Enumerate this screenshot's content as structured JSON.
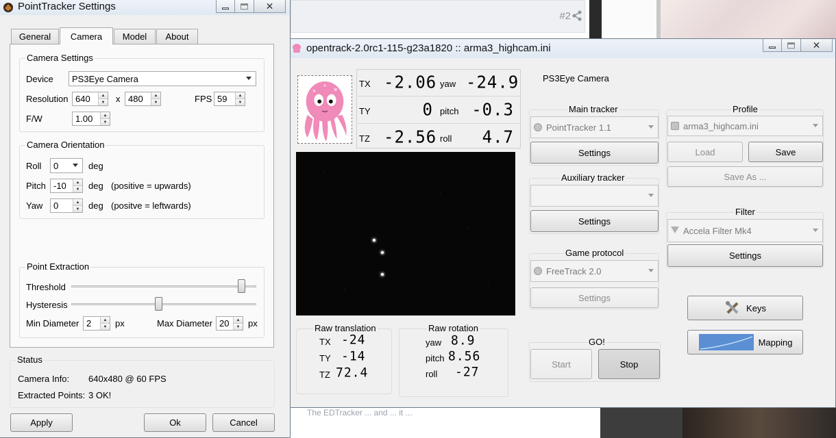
{
  "background": {
    "post_number": "#2",
    "bottom_hint": "The EDTracker ... and ... it ..."
  },
  "pointtracker": {
    "title": "PointTracker Settings",
    "tabs": [
      "General",
      "Camera",
      "Model",
      "About"
    ],
    "active_tab": "Camera",
    "camera_settings": {
      "group_label": "Camera Settings",
      "device_label": "Device",
      "device_value": "PS3Eye Camera",
      "resolution_label": "Resolution",
      "res_width": "640",
      "res_x": "x",
      "res_height": "480",
      "fps_label": "FPS",
      "fps_value": "59",
      "fw_label": "F/W",
      "fw_value": "1.00"
    },
    "orientation": {
      "group_label": "Camera Orientation",
      "roll_label": "Roll",
      "roll_value": "0",
      "pitch_label": "Pitch",
      "pitch_value": "-10",
      "yaw_label": "Yaw",
      "yaw_value": "0",
      "deg": "deg",
      "pitch_hint": "(positive = upwards)",
      "yaw_hint": "(positve = leftwards)"
    },
    "extraction": {
      "group_label": "Point Extraction",
      "threshold_label": "Threshold",
      "threshold_level": 0.94,
      "hysteresis_label": "Hysteresis",
      "hysteresis_level": 0.47,
      "min_diameter_label": "Min Diameter",
      "min_diameter": "2",
      "max_diameter_label": "Max Diameter",
      "max_diameter": "20",
      "px": "px"
    },
    "status": {
      "group_label": "Status",
      "camera_info_label": "Camera Info:",
      "camera_info_value": "640x480 @ 60 FPS",
      "points_label": "Extracted Points:",
      "points_value": "3 OK!"
    },
    "buttons": {
      "apply": "Apply",
      "ok": "Ok",
      "cancel": "Cancel"
    }
  },
  "opentrack": {
    "title": "opentrack-2.0rc1-115-g23a1820 :: arma3_highcam.ini",
    "camera_name": "PS3Eye Camera",
    "pose": {
      "tx_label": "TX",
      "tx": "-2.06",
      "ty_label": "TY",
      "ty": "0",
      "tz_label": "TZ",
      "tz": "-2.56",
      "yaw_label": "yaw",
      "yaw": "-24.9",
      "pitch_label": "pitch",
      "pitch": "-0.3",
      "roll_label": "roll",
      "roll": "4.7"
    },
    "raw_translation": {
      "label": "Raw translation",
      "tx_label": "TX",
      "tx": "-24",
      "ty_label": "TY",
      "ty": "-14",
      "tz_label": "TZ",
      "tz": "72.4"
    },
    "raw_rotation": {
      "label": "Raw rotation",
      "yaw_label": "yaw",
      "yaw": "8.9",
      "pitch_label": "pitch",
      "pitch": "8.56",
      "roll_label": "roll",
      "roll": "-27"
    },
    "main_tracker": {
      "label": "Main tracker",
      "value": "PointTracker 1.1",
      "settings": "Settings"
    },
    "aux_tracker": {
      "label": "Auxiliary tracker",
      "value": "",
      "settings": "Settings"
    },
    "game_protocol": {
      "label": "Game protocol",
      "value": "FreeTrack 2.0",
      "settings": "Settings"
    },
    "profile": {
      "label": "Profile",
      "value": "arma3_highcam.ini",
      "load": "Load",
      "save": "Save",
      "save_as": "Save As ..."
    },
    "filter": {
      "label": "Filter",
      "value": "Accela Filter Mk4",
      "settings": "Settings"
    },
    "keys": "Keys",
    "mapping": "Mapping",
    "go": {
      "label": "GO!",
      "start": "Start",
      "stop": "Stop"
    },
    "colors": {
      "mascot": "#f08ab8",
      "camera_bg": "#060606"
    }
  }
}
